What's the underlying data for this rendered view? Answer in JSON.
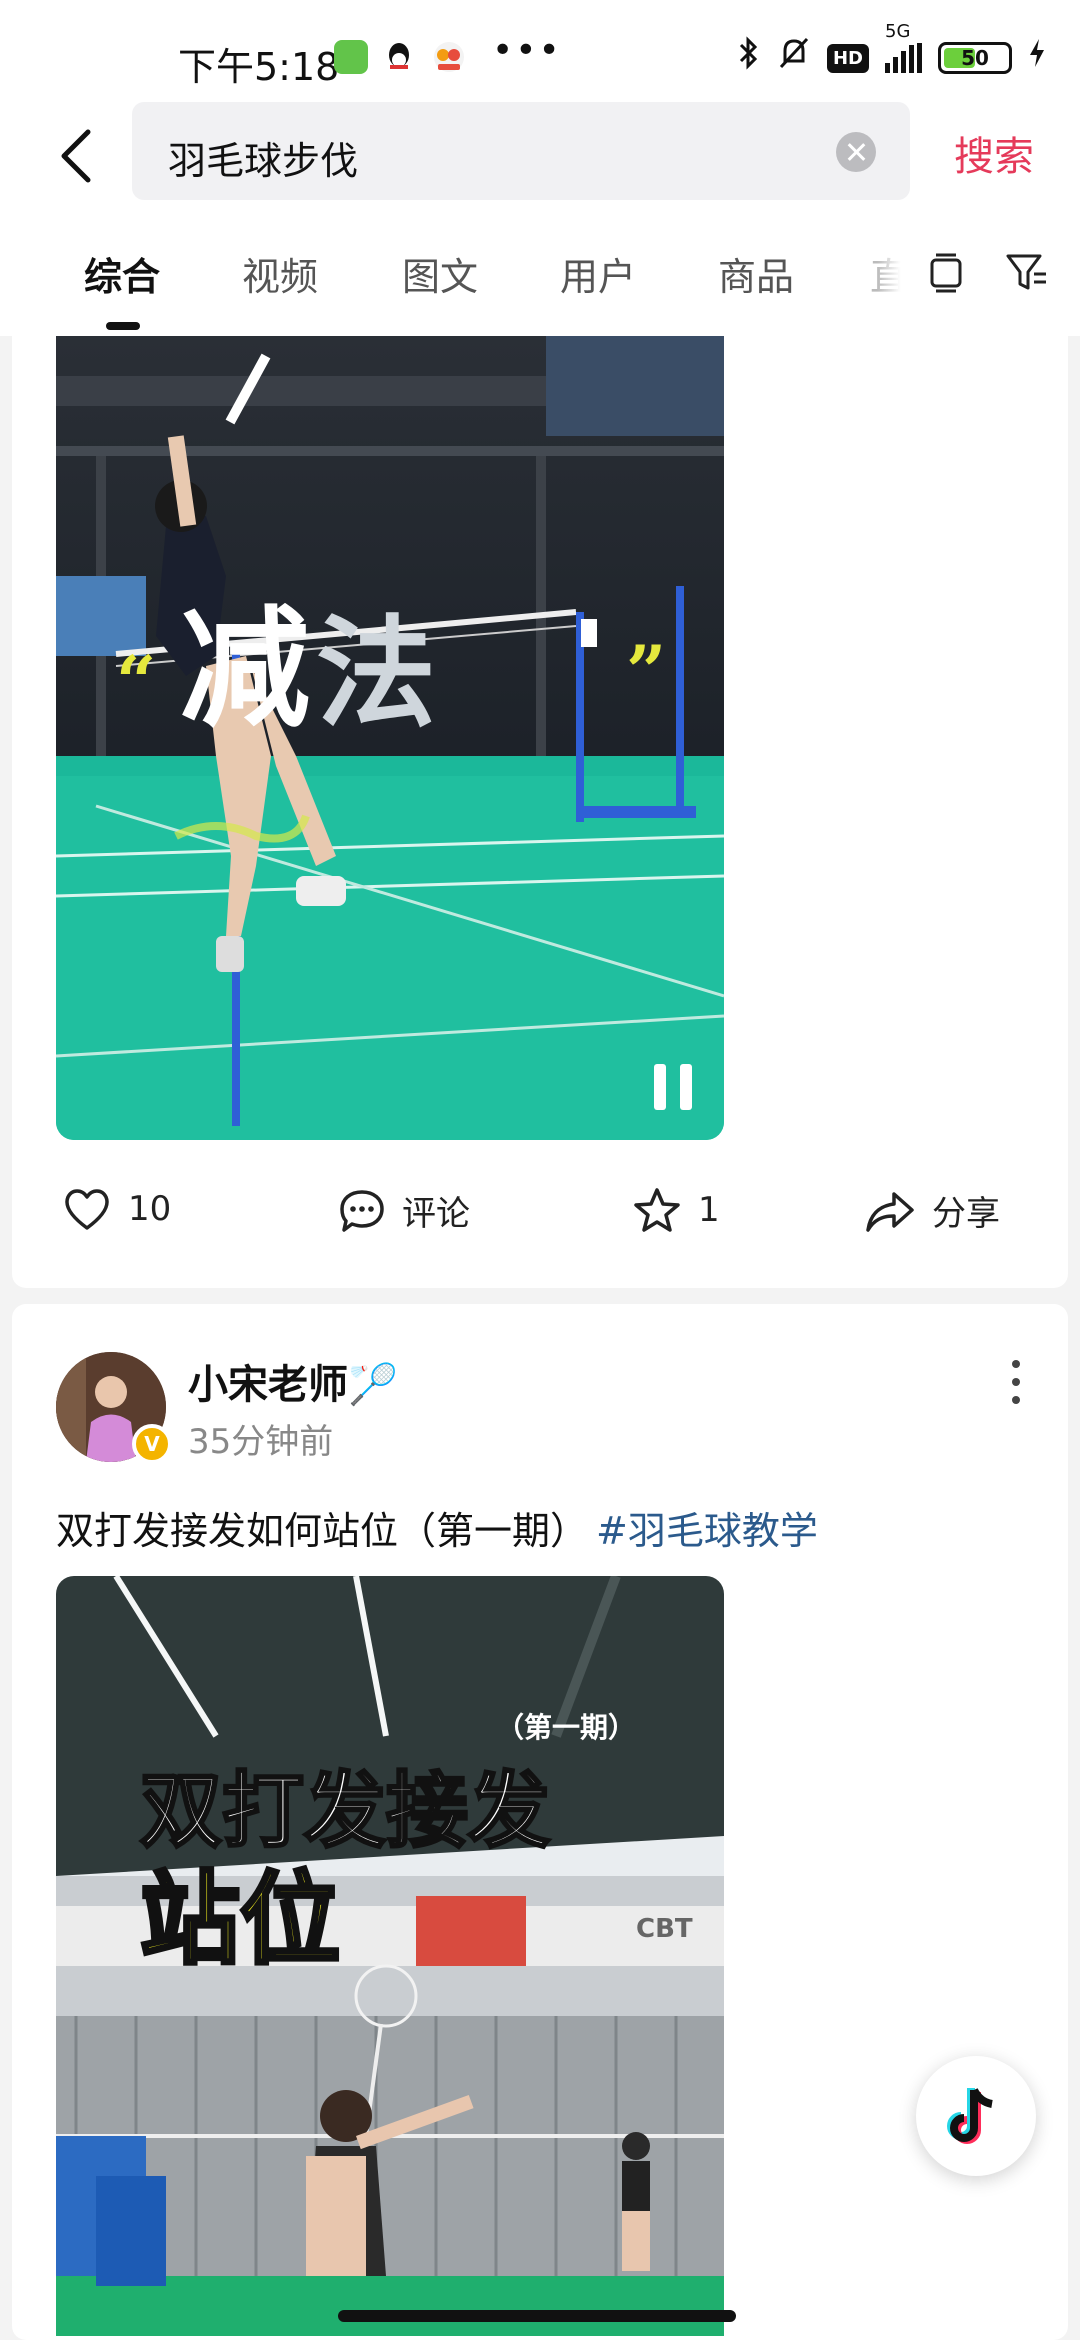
{
  "status_bar": {
    "time": "下午5:18",
    "network": "5G",
    "hd": "HD",
    "battery": "50",
    "battery_level": 0.5
  },
  "search": {
    "query": "羽毛球步伐",
    "submit_label": "搜索"
  },
  "tabs": [
    {
      "label": "综合",
      "active": true
    },
    {
      "label": "视频"
    },
    {
      "label": "图文"
    },
    {
      "label": "用户"
    },
    {
      "label": "商品"
    },
    {
      "label": "直"
    }
  ],
  "post1": {
    "overlay_text": [
      "减",
      "法"
    ],
    "actions": {
      "like_count": "10",
      "comment_label": "评论",
      "favorite_count": "1",
      "share_label": "分享"
    }
  },
  "post2": {
    "author": "小宋老师🏸",
    "verified_badge": "V",
    "time_ago": "35分钟前",
    "caption": "双打发接发如何站位（第一期）",
    "hashtag": "#羽毛球教学",
    "thumbnail_text": {
      "issue": "（第一期）",
      "line1": "双打发接发",
      "line2": "站位",
      "sign": "CBT"
    }
  },
  "colors": {
    "accent": "#e53a5a",
    "hashtag": "#2b5a8c",
    "court": "#1bb89a"
  },
  "icons": {
    "fab": "douyin-icon"
  }
}
